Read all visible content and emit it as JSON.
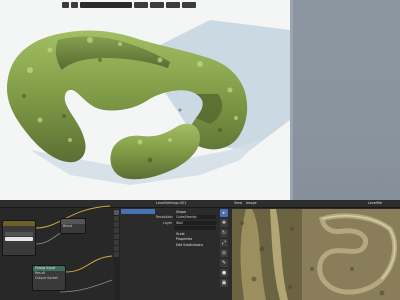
{
  "viewport": {
    "header_field": "",
    "shading_modes": [
      "",
      "",
      "",
      ""
    ],
    "colors": {
      "background": "#f4f5f5",
      "wall": "#8a949f",
      "rock_light": "#8fae52",
      "rock_dark": "#5a6e34",
      "shadow": "#b8cad7"
    }
  },
  "node_editor": {
    "nodes": [
      {
        "title": "",
        "rows": [
          "",
          "",
          ""
        ],
        "fields": [
          "",
          ""
        ]
      },
      {
        "title": "",
        "rows": [
          "Blend",
          "Result"
        ],
        "fields": []
      },
      {
        "title": "Group Input",
        "rows": [
          "Result",
          "Output Socket"
        ],
        "fields": []
      }
    ]
  },
  "outliner": {
    "items": [
      "",
      "",
      "",
      "",
      "",
      "",
      "",
      "",
      "",
      "",
      "",
      "",
      "",
      "",
      ""
    ],
    "selected_index": 0
  },
  "properties": {
    "header": "LevelSettings.001",
    "rows": [
      {
        "label": "",
        "value": "Shape"
      },
      {
        "label": "Resolution",
        "value": "Cube/Nearby"
      },
      {
        "label": "Layer",
        "value": "Wall"
      },
      {
        "label": "",
        "value": ""
      },
      {
        "label": "",
        "value": "Scale"
      },
      {
        "label": "",
        "value": "Properties"
      },
      {
        "label": "",
        "value": "Edit Subdivisions"
      }
    ]
  },
  "image_editor": {
    "menu": [
      "View",
      "Image"
    ],
    "image_name": "Levelfile",
    "tools": [
      "cursor-icon",
      "move-icon",
      "rotate-icon",
      "scale-icon",
      "sample-icon",
      "annotate-icon",
      "brush-icon",
      "fill-icon",
      "smear-icon",
      "clone-icon"
    ]
  }
}
